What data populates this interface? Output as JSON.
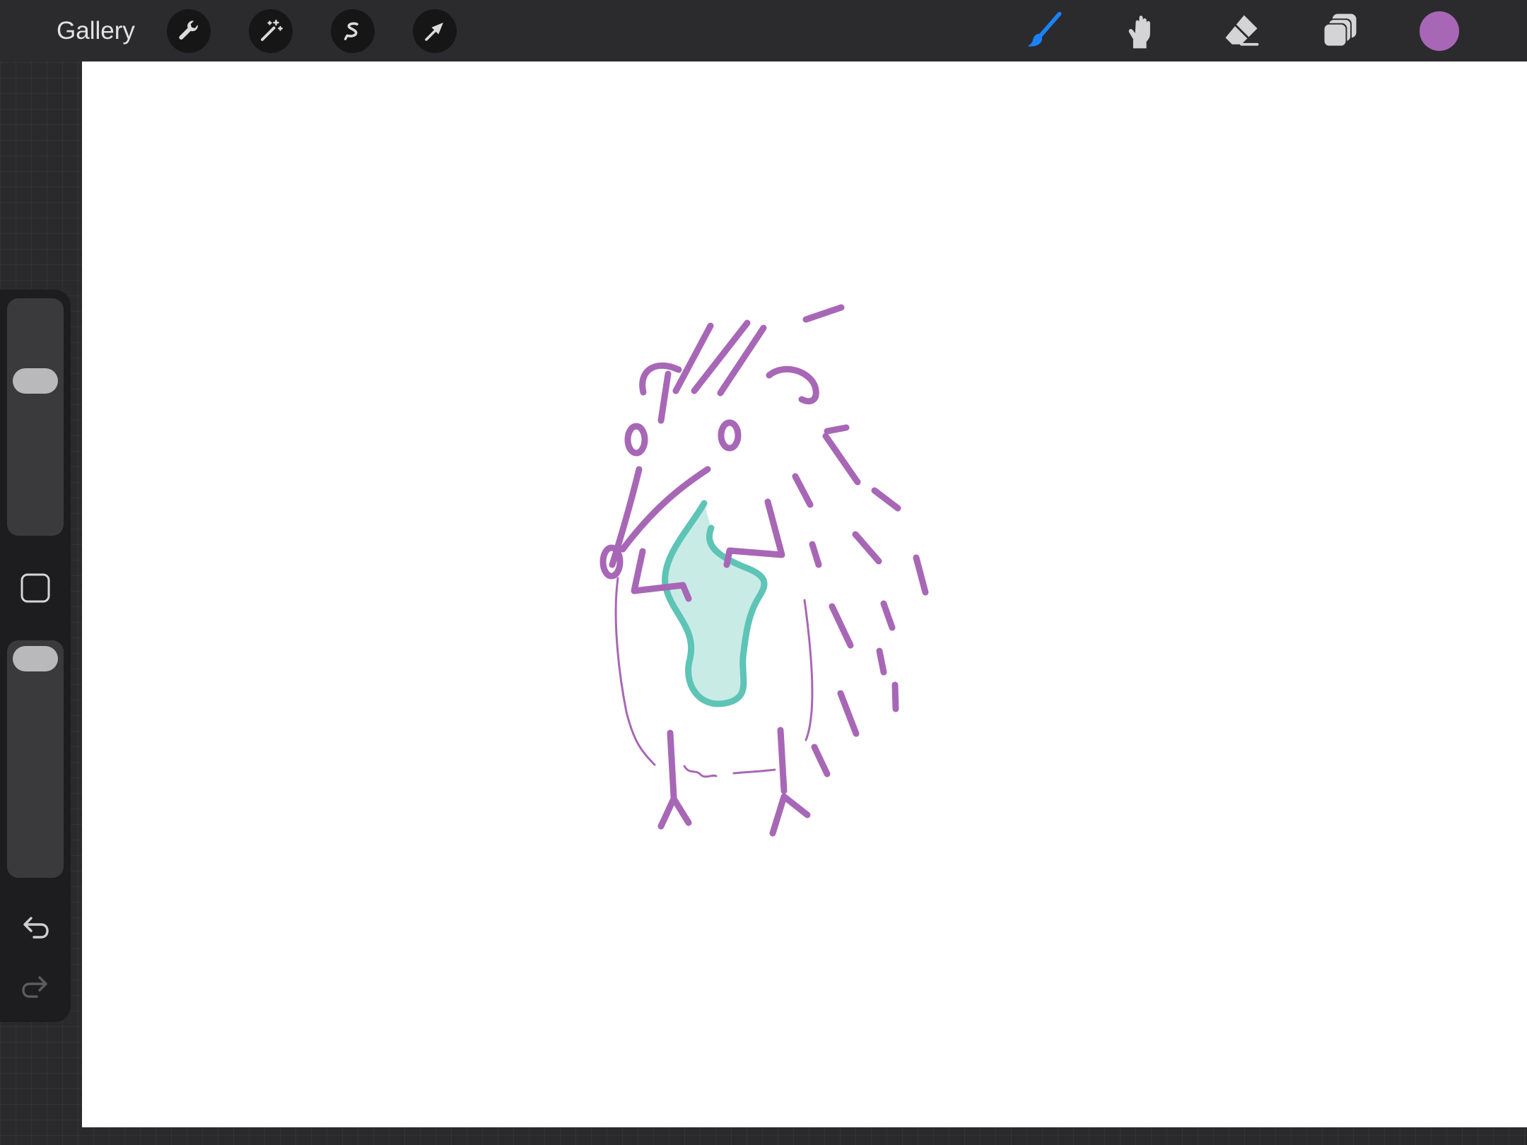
{
  "topbar": {
    "gallery_label": "Gallery",
    "left_tools": [
      {
        "name": "actions",
        "icon": "wrench-icon"
      },
      {
        "name": "adjustments",
        "icon": "magic-wand-icon"
      },
      {
        "name": "selection",
        "icon": "selection-icon"
      },
      {
        "name": "transform",
        "icon": "transform-arrow-icon"
      }
    ],
    "right_tools": [
      {
        "name": "brush",
        "icon": "brush-icon",
        "active": true
      },
      {
        "name": "smudge",
        "icon": "smudge-finger-icon"
      },
      {
        "name": "eraser",
        "icon": "eraser-icon"
      },
      {
        "name": "layers",
        "icon": "layers-icon"
      }
    ],
    "current_color": "#a867b6"
  },
  "sidebar": {
    "brush_size_level": 0.68,
    "opacity_level": 1.0,
    "buttons": [
      {
        "name": "modify",
        "icon": "square-icon"
      },
      {
        "name": "undo",
        "icon": "undo-icon",
        "enabled": true
      },
      {
        "name": "redo",
        "icon": "redo-icon",
        "enabled": false
      }
    ]
  },
  "colors": {
    "accent_blue": "#1a82fb",
    "stroke_purple": "#a867b6",
    "stroke_teal": "#5dc4b6",
    "fill_teal": "#c9ebe6"
  }
}
